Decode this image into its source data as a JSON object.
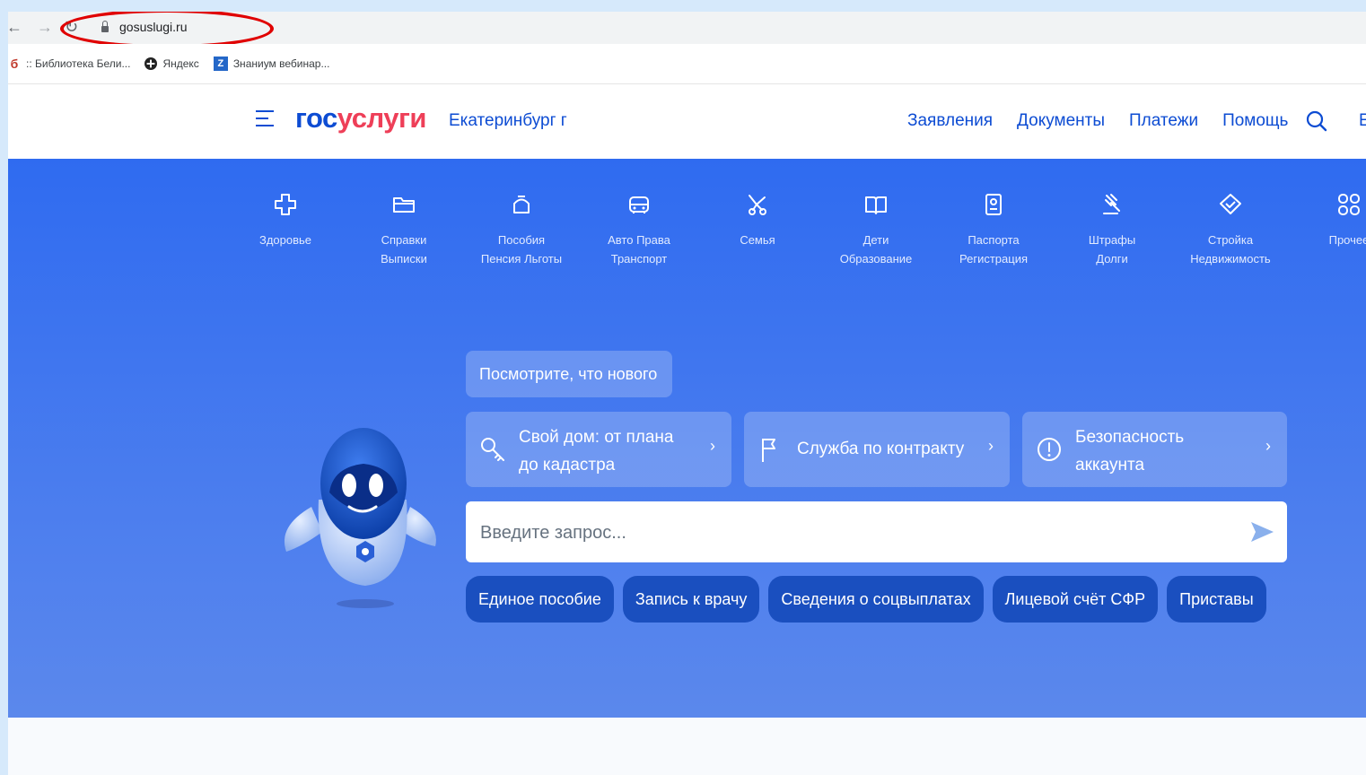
{
  "browser": {
    "url": "gosuslugi.ru",
    "bookmarks": [
      {
        "icon": "b",
        "label": ":: Библиотека Бели..."
      },
      {
        "icon": "yandex",
        "label": "Яндекс"
      },
      {
        "icon": "Z",
        "label": "Знаниум вебинар..."
      }
    ]
  },
  "header": {
    "logo_part1": "гос",
    "logo_part2": "услуги",
    "city": "Екатеринбург г",
    "nav": [
      "Заявления",
      "Документы",
      "Платежи",
      "Помощь"
    ],
    "cut_item": "Е"
  },
  "categories": [
    {
      "icon": "health-cross-icon",
      "line1": "Здоровье",
      "line2": ""
    },
    {
      "icon": "folder-icon",
      "line1": "Справки",
      "line2": "Выписки"
    },
    {
      "icon": "wallet-icon",
      "line1": "Пособия",
      "line2": "Пенсия Льготы"
    },
    {
      "icon": "car-icon",
      "line1": "Авто Права",
      "line2": "Транспорт"
    },
    {
      "icon": "stroller-icon",
      "line1": "Семья",
      "line2": ""
    },
    {
      "icon": "book-icon",
      "line1": "Дети",
      "line2": "Образование"
    },
    {
      "icon": "passport-icon",
      "line1": "Паспорта",
      "line2": "Регистрация"
    },
    {
      "icon": "gavel-icon",
      "line1": "Штрафы",
      "line2": "Долги"
    },
    {
      "icon": "house-icon",
      "line1": "Стройка",
      "line2": "Недвижимость"
    },
    {
      "icon": "grid-icon",
      "line1": "Прочее",
      "line2": ""
    }
  ],
  "hero": {
    "whats_new": "Посмотрите, что нового",
    "cards": [
      {
        "icon": "key-icon",
        "line1": "Свой дом: от плана",
        "line2": "до кадастра"
      },
      {
        "icon": "flag-icon",
        "line1": "Служба по контракту",
        "line2": ""
      },
      {
        "icon": "alert-icon",
        "line1": "Безопасность",
        "line2": "аккаунта"
      }
    ],
    "search_placeholder": "Введите запрос...",
    "chips": [
      "Единое пособие",
      "Запись к врачу",
      "Сведения о соцвыплатах",
      "Лицевой счёт СФР",
      "Приставы"
    ]
  },
  "colors": {
    "brand_blue": "#0d4cd3",
    "brand_red": "#ee3f58",
    "hero_bg": "#2f6bf0",
    "chip_bg": "#1a4fbf",
    "annotation_red": "#e00000"
  }
}
